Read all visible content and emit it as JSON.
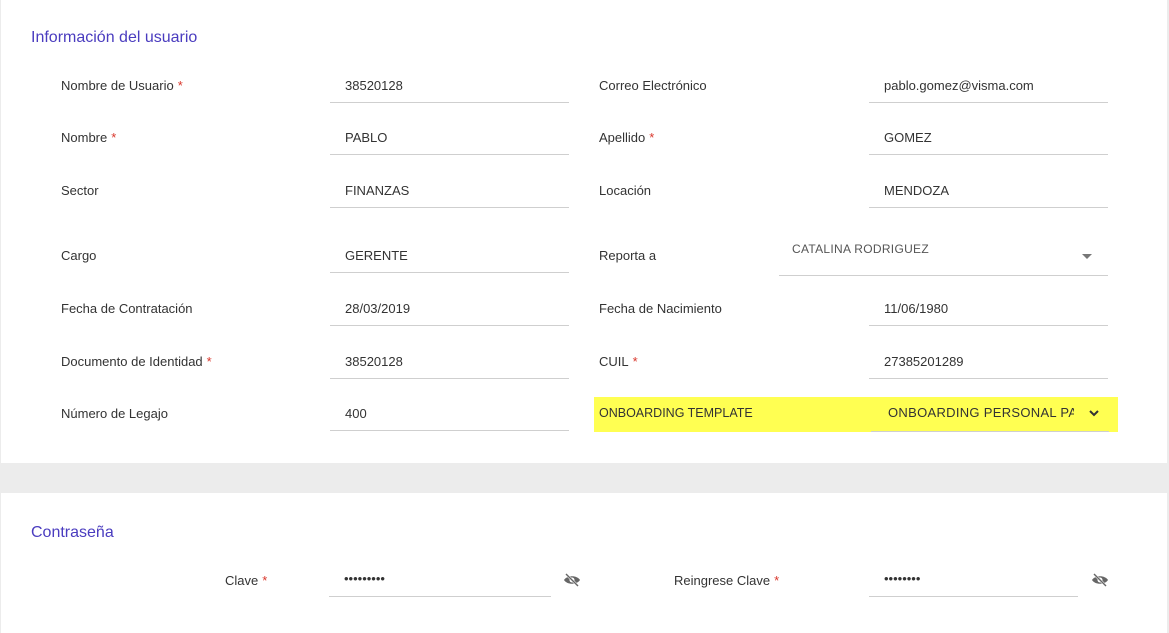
{
  "user_info": {
    "title": "Información del usuario",
    "username": {
      "label": "Nombre de Usuario",
      "value": "38520128"
    },
    "email": {
      "label": "Correo Electrónico",
      "value": "pablo.gomez@visma.com"
    },
    "first_name": {
      "label": "Nombre",
      "value": "PABLO"
    },
    "last_name": {
      "label": "Apellido",
      "value": "GOMEZ"
    },
    "sector": {
      "label": "Sector",
      "value": "FINANZAS"
    },
    "location": {
      "label": "Locación",
      "value": "MENDOZA"
    },
    "position": {
      "label": "Cargo",
      "value": "GERENTE"
    },
    "reports_to": {
      "label": "Reporta a",
      "value": "CATALINA RODRIGUEZ"
    },
    "hire_date": {
      "label": "Fecha de Contratación",
      "value": "28/03/2019"
    },
    "birth_date": {
      "label": "Fecha de Nacimiento",
      "value": "11/06/1980"
    },
    "id_document": {
      "label": "Documento de Identidad",
      "value": "38520128"
    },
    "cuil": {
      "label": "CUIL",
      "value": "27385201289"
    },
    "file_number": {
      "label": "Número de Legajo",
      "value": "400"
    },
    "onboarding_template": {
      "label": "ONBOARDING TEMPLATE",
      "value": "ONBOARDING PERSONAL PASANTE"
    },
    "required_mark": "*",
    "highlight_color": "#ffff52"
  },
  "password": {
    "title": "Contraseña",
    "key": {
      "label": "Clave",
      "value": "•••••••••"
    },
    "repeat_key": {
      "label": "Reingrese Clave",
      "value": "••••••••"
    },
    "toggle_icon": "eye-off-icon"
  },
  "colors": {
    "accent": "#4a3cbf",
    "required": "#d9362b"
  }
}
